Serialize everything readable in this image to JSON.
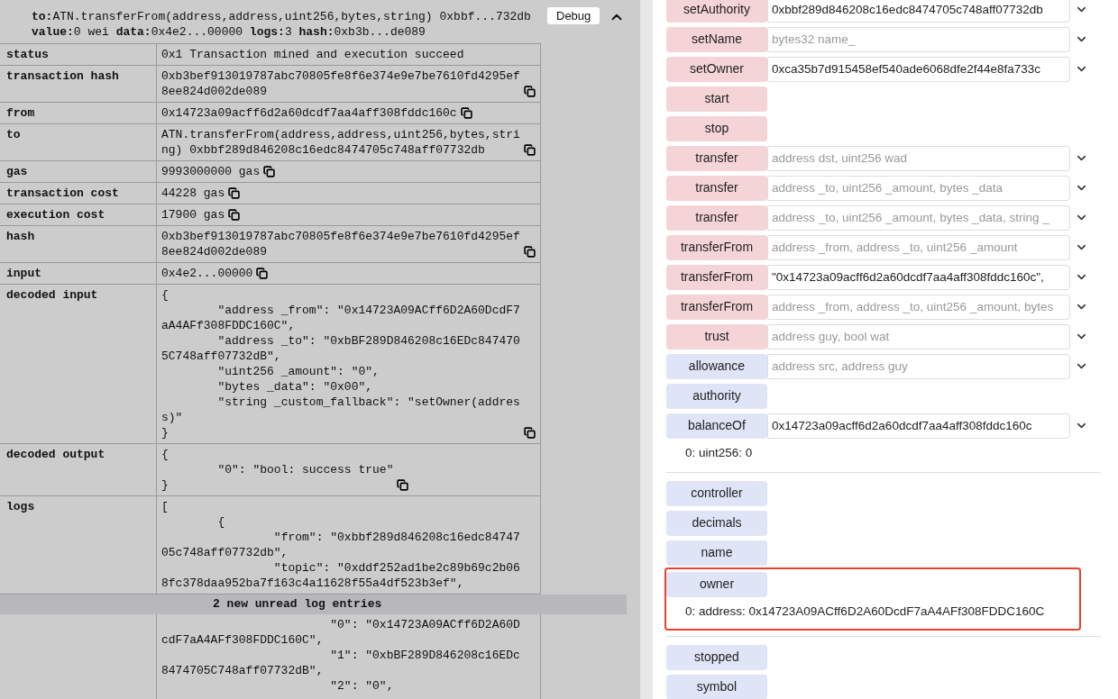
{
  "transaction": {
    "summary": "**to:**ATN.transferFrom(address,address,uint256,bytes,string) 0xbbf...732db",
    "details": "**value:**0 wei **data:**0x4e2...00000 **logs:**3 **hash:**0xb3b...de089",
    "debug_button": "Debug",
    "expanded": true
  },
  "rows": [
    {
      "label": "status",
      "value": "0x1 Transaction mined and execution succeed",
      "copy": false
    },
    {
      "label": "transaction hash",
      "value": "0xb3bef913019787abc70805fe8f6e374e9e7be7610fd4295ef8ee824d002de089",
      "copy": true
    },
    {
      "label": "from",
      "value": "0x14723a09acff6d2a60dcdf7aa4aff308fddc160c",
      "copy": true
    },
    {
      "label": "to",
      "value": "ATN.transferFrom(address,address,uint256,bytes,string) 0xbbf289d846208c16edc8474705c748aff07732db",
      "copy": true
    },
    {
      "label": "gas",
      "value": "9993000000 gas",
      "copy": true
    },
    {
      "label": "transaction cost",
      "value": "44228 gas",
      "copy": true
    },
    {
      "label": "execution cost",
      "value": "17900 gas",
      "copy": true
    },
    {
      "label": "hash",
      "value": "0xb3bef913019787abc70805fe8f6e374e9e7be7610fd4295ef8ee824d002de089",
      "copy": true
    },
    {
      "label": "input",
      "value": "0x4e2...00000",
      "copy": true
    },
    {
      "label": "decoded input",
      "value": "{\n\t\"address _from\": \"0x14723A09ACff6D2A60DcdF7aA4AFf308FDDC160C\",\n\t\"address _to\": \"0xbBF289D846208c16EDc8474705C748aff07732dB\",\n\t\"uint256 _amount\": \"0\",\n\t\"bytes _data\": \"0x00\",\n\t\"string _custom_fallback\": \"setOwner(address)\"\n}",
      "copy": true
    },
    {
      "label": "decoded output",
      "value": "{\n\t\"0\": \"bool: success true\"\n}",
      "copy": true
    },
    {
      "label": "logs",
      "value": "[\n\t{\n\t\t\"from\": \"0xbbf289d846208c16edc8474705c748aff07732db\",\n\t\t\"topic\": \"0xddf252ad1be2c89b69c2b068fc378daa952ba7f163c4a11628f55a4df523b3ef\",",
      "copy": false
    }
  ],
  "notification": "2 new unread log entries",
  "logs_continued": "\t\t\t\"0\": \"0x14723A09ACff6D2A60DcdF7aA4AFf308FDDC160C\",\n\t\t\t\"1\": \"0xbBF289D846208c16EDc8474705C748aff07732dB\",\n\t\t\t\"2\": \"0\",",
  "functions": [
    {
      "kind": "transact",
      "label": "setAuthority",
      "value": "0xbbf289d846208c16edc8474705c748aff07732db"
    },
    {
      "kind": "transact",
      "label": "setName",
      "placeholder": "bytes32 name_"
    },
    {
      "kind": "transact",
      "label": "setOwner",
      "value": "0xca35b7d915458ef540ade6068dfe2f44e8fa733c"
    },
    {
      "kind": "transact",
      "label": "start"
    },
    {
      "kind": "transact",
      "label": "stop"
    },
    {
      "kind": "transact",
      "label": "transfer",
      "placeholder": "address dst, uint256 wad"
    },
    {
      "kind": "transact",
      "label": "transfer",
      "placeholder": "address _to, uint256 _amount, bytes _data"
    },
    {
      "kind": "transact",
      "label": "transfer",
      "placeholder": "address _to, uint256 _amount, bytes _data, string _"
    },
    {
      "kind": "transact",
      "label": "transferFrom",
      "placeholder": "address _from, address _to, uint256 _amount"
    },
    {
      "kind": "transact",
      "label": "transferFrom",
      "value": "\"0x14723a09acff6d2a60dcdf7aa4aff308fddc160c\","
    },
    {
      "kind": "transact",
      "label": "transferFrom",
      "placeholder": "address _from, address _to, uint256 _amount, bytes"
    },
    {
      "kind": "transact",
      "label": "trust",
      "placeholder": "address guy, bool wat"
    },
    {
      "kind": "call",
      "label": "allowance",
      "placeholder": "address src, address guy"
    },
    {
      "kind": "call",
      "label": "authority"
    },
    {
      "kind": "call",
      "label": "balanceOf",
      "value": "0x14723a09acff6d2a60dcdf7aa4aff308fddc160c",
      "output": "0: uint256: 0"
    },
    {
      "kind": "call",
      "label": "controller"
    },
    {
      "kind": "call",
      "label": "decimals"
    },
    {
      "kind": "call",
      "label": "name"
    },
    {
      "kind": "call",
      "label": "owner",
      "output": "0: address: 0x14723A09ACff6D2A60DcdF7aA4AFf308FDDC160C",
      "highlighted": true
    },
    {
      "kind": "call",
      "label": "stopped"
    },
    {
      "kind": "call",
      "label": "symbol"
    }
  ]
}
